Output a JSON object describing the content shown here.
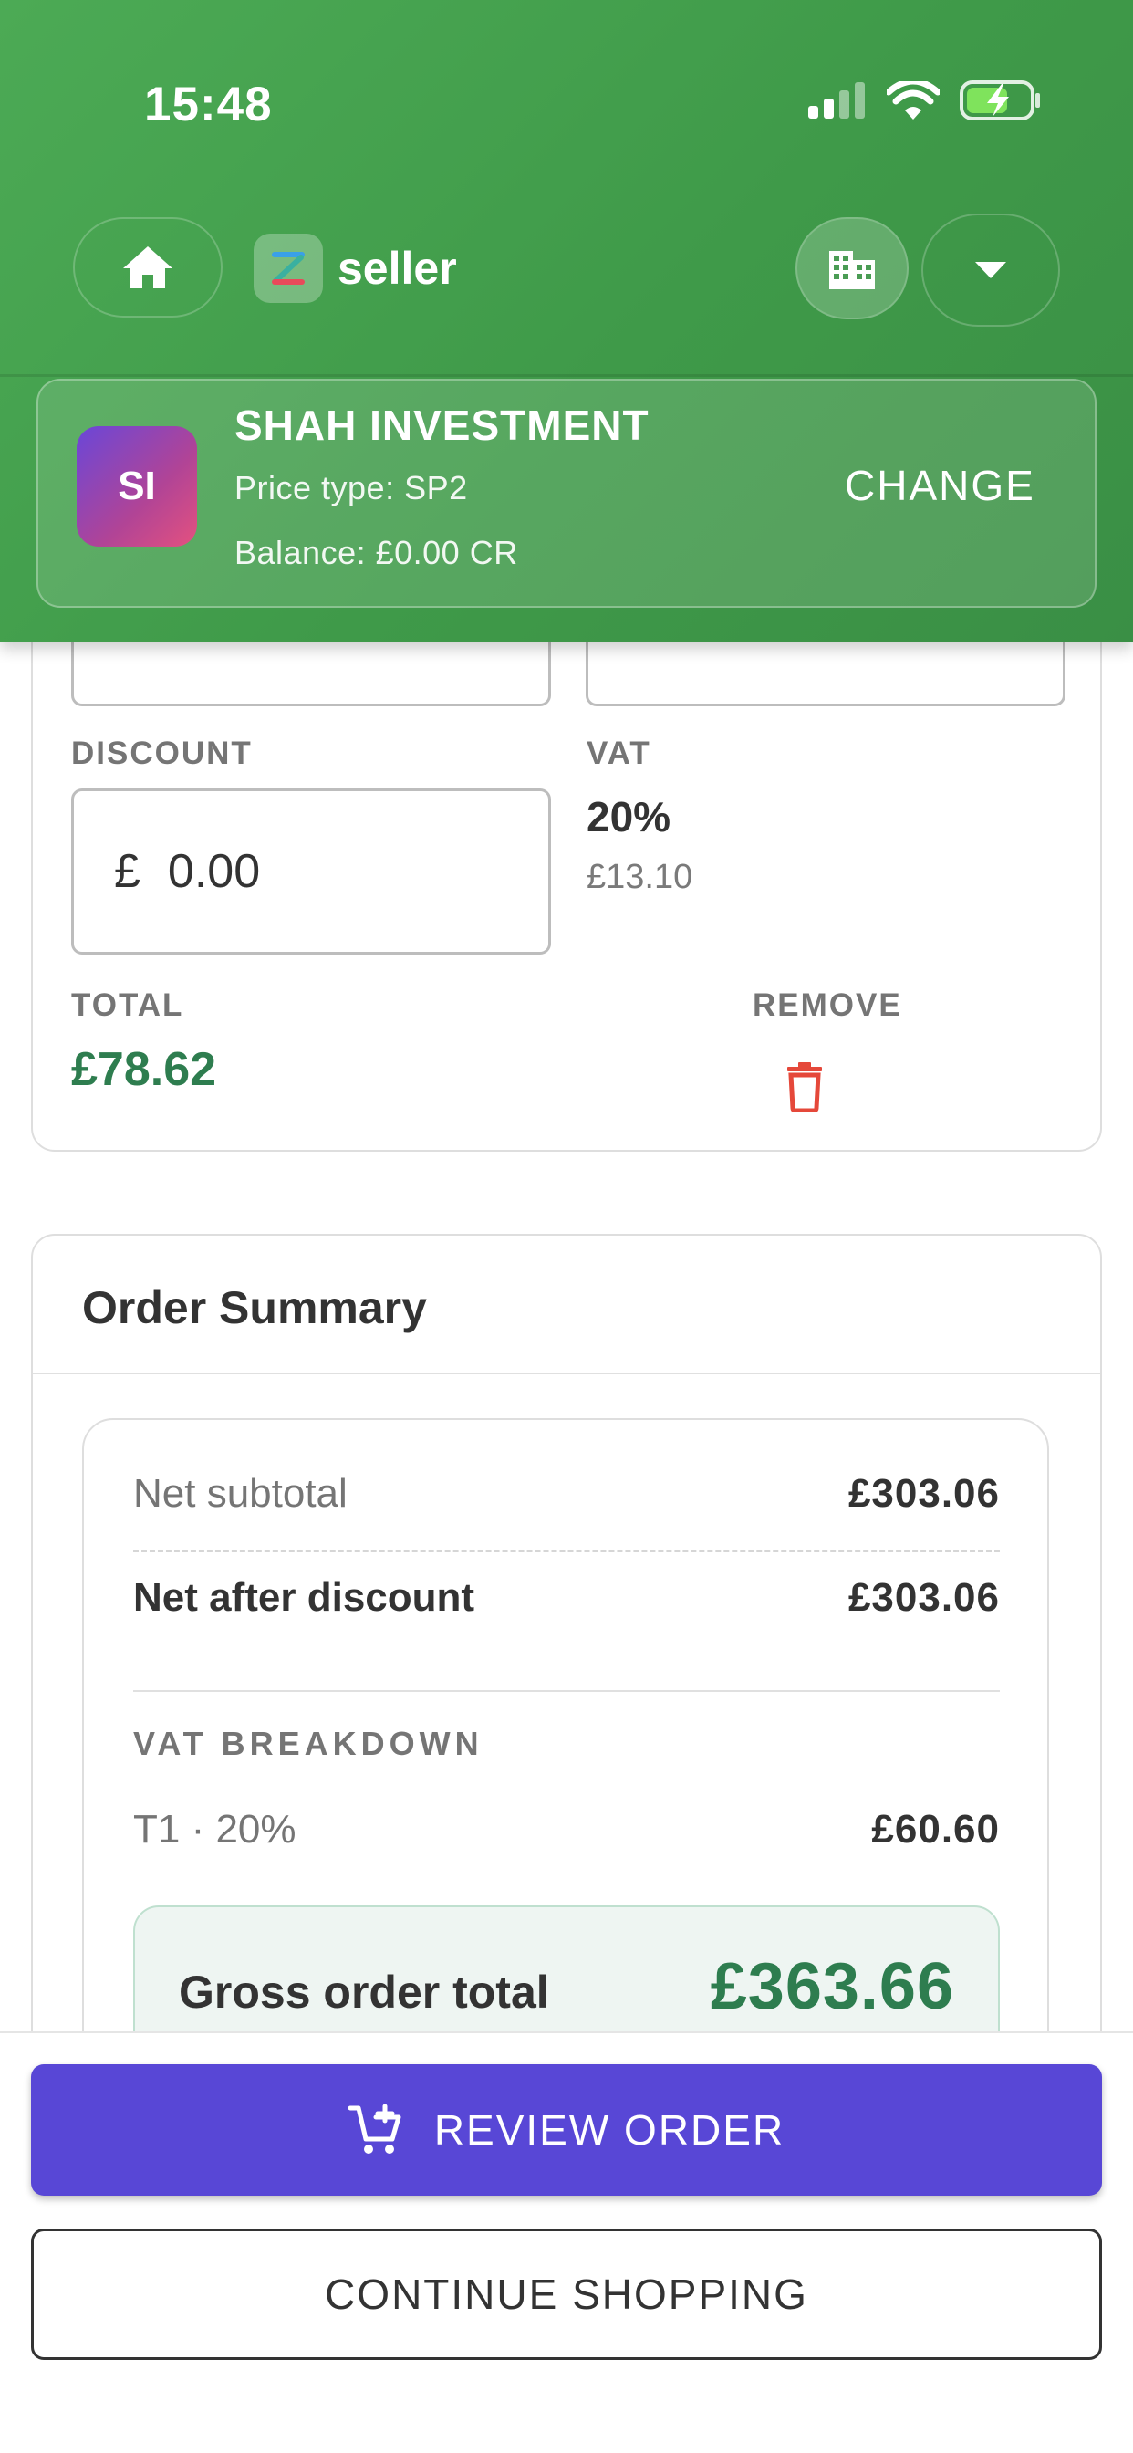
{
  "status_bar": {
    "time": "15:48",
    "icons": [
      "signal-icon",
      "wifi-icon",
      "battery-charging-icon"
    ]
  },
  "header": {
    "brand_name": "seller",
    "home_icon": "home-icon",
    "building_icon": "building-icon",
    "dropdown_icon": "caret-down-icon",
    "colors": {
      "header_green": "#43a04d"
    }
  },
  "customer": {
    "initials": "SI",
    "name": "SHAH INVESTMENT",
    "price_type": "Price type: SP2",
    "balance": "Balance: £0.00 CR",
    "change_label": "CHANGE"
  },
  "item": {
    "discount_label": "DISCOUNT",
    "discount_currency": "£",
    "discount_value": "0.00",
    "vat_label": "VAT",
    "vat_percent": "20%",
    "vat_amount": "£13.10",
    "total_label": "TOTAL",
    "total_value": "£78.62",
    "remove_label": "REMOVE",
    "colors": {
      "total_green": "#2e7d4f",
      "remove_red": "#e5483a"
    }
  },
  "summary": {
    "title": "Order Summary",
    "net_subtotal_label": "Net subtotal",
    "net_subtotal_value": "£303.06",
    "net_after_discount_label": "Net after discount",
    "net_after_discount_value": "£303.06",
    "vat_breakdown_label": "VAT BREAKDOWN",
    "vat_rows": [
      {
        "label": "T1 · 20%",
        "value": "£60.60"
      }
    ],
    "gross_label": "Gross order total",
    "gross_value": "£363.66"
  },
  "actions": {
    "review_label": "REVIEW ORDER",
    "continue_label": "CONTINUE SHOPPING",
    "colors": {
      "primary": "#5847d6"
    }
  }
}
